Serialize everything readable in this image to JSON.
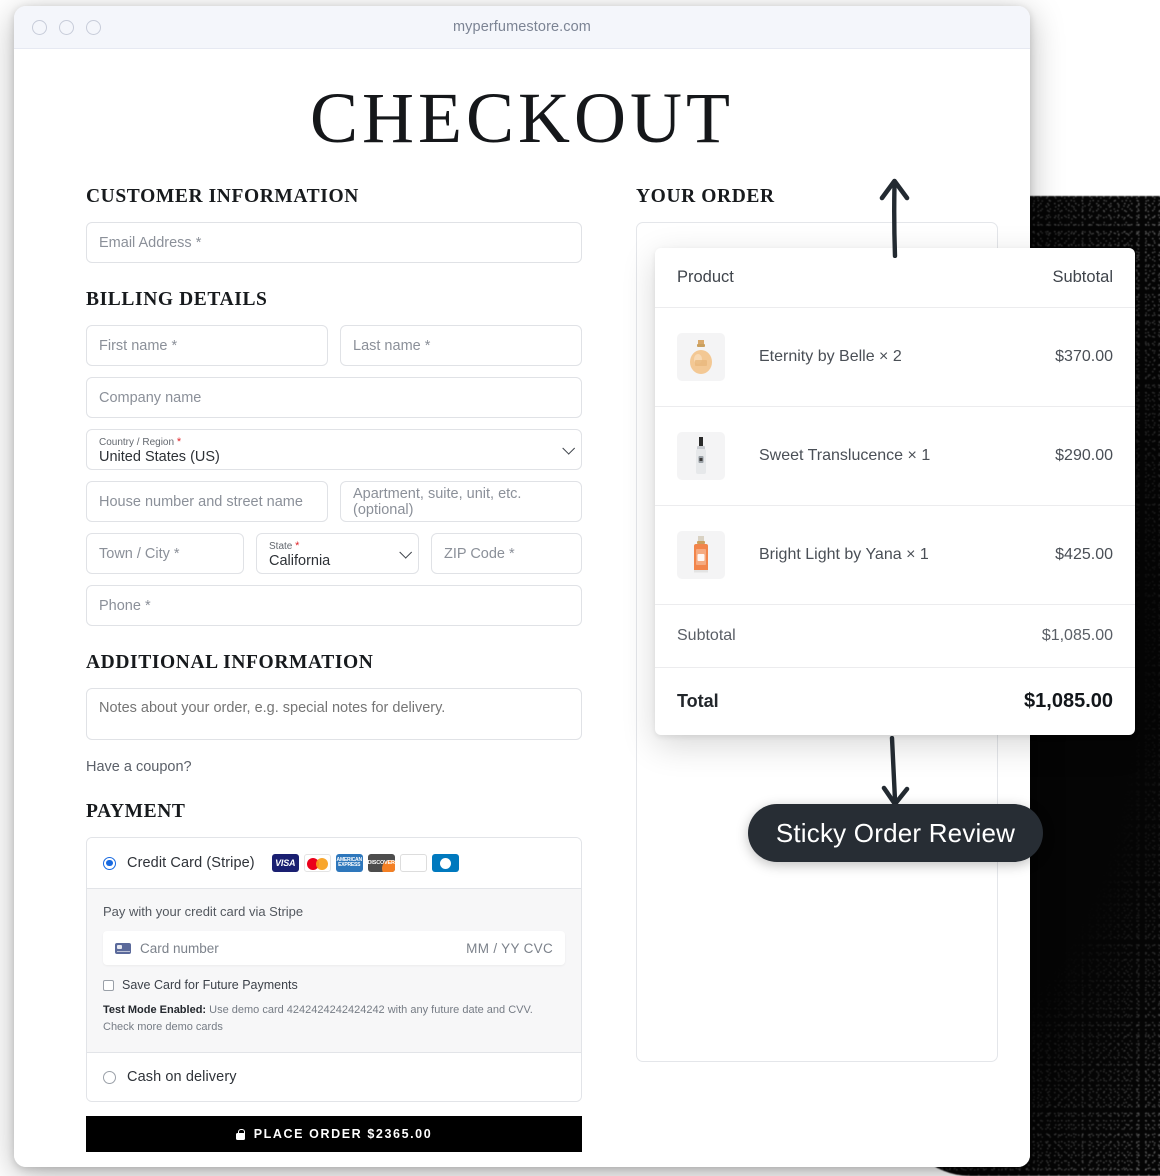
{
  "browser": {
    "url": "myperfumestore.com",
    "traffic_lights": [
      "close-light",
      "minimize-light",
      "zoom-light"
    ]
  },
  "page": {
    "title": "CHECKOUT"
  },
  "customer_information": {
    "heading": "CUSTOMER INFORMATION",
    "email_placeholder": "Email Address *"
  },
  "billing_details": {
    "heading": "BILLING DETAILS",
    "first_name_placeholder": "First name *",
    "last_name_placeholder": "Last name *",
    "company_placeholder": "Company name",
    "country_label": "Country / Region",
    "country_value": "United States (US)",
    "street_placeholder": "House number and street name",
    "apartment_placeholder": "Apartment, suite, unit, etc. (optional)",
    "city_placeholder": "Town / City *",
    "state_label": "State",
    "state_value": "California",
    "zip_placeholder": "ZIP Code *",
    "phone_placeholder": "Phone *",
    "required_mark": "*"
  },
  "additional_information": {
    "heading": "ADDITIONAL INFORMATION",
    "notes_placeholder": "Notes about your order, e.g. special notes for delivery.",
    "coupon_text": "Have a coupon?"
  },
  "payment": {
    "heading": "PAYMENT",
    "methods": [
      {
        "label": "Credit Card (Stripe)",
        "selected": true
      },
      {
        "label": "Cash on delivery",
        "selected": false
      }
    ],
    "card_brands": [
      "visa-icon",
      "mastercard-icon",
      "amex-icon",
      "discover-icon",
      "jcb-icon",
      "diners-icon"
    ],
    "amex_text": "AMERICAN EXPRESS",
    "discover_text": "DISCOVER",
    "stripe_description": "Pay with your credit card via Stripe",
    "card_number_placeholder": "Card number",
    "card_expiry_cvc": "MM / YY  CVC",
    "save_card_label": "Save Card for Future Payments",
    "test_mode_bold": "Test Mode Enabled:",
    "test_mode_text": " Use demo card 4242424242424242 with any future date and CVV. Check more demo cards",
    "place_order_label": "PLACE ORDER $2365.00"
  },
  "order": {
    "heading": "YOUR ORDER",
    "col_product": "Product",
    "col_subtotal": "Subtotal",
    "items": [
      {
        "name": "Eternity by Belle × 2",
        "price": "$370.00",
        "thumb": "perfume-bottle-gold"
      },
      {
        "name": "Sweet Translucence × 1",
        "price": "$290.00",
        "thumb": "perfume-bottle-silver"
      },
      {
        "name": "Bright Light by Yana × 1",
        "price": "$425.00",
        "thumb": "perfume-bottle-orange"
      }
    ],
    "subtotal_label": "Subtotal",
    "subtotal_value": "$1,085.00",
    "total_label": "Total",
    "total_value": "$1,085.00"
  },
  "annotation": {
    "pill_label": "Sticky Order Review",
    "arrow_up": "arrow-up-icon",
    "arrow_down": "arrow-down-icon"
  },
  "colors": {
    "accent": "#1769e0",
    "place_order_bg": "#000000",
    "pill_bg": "#272d34",
    "required": "#e0252a"
  }
}
